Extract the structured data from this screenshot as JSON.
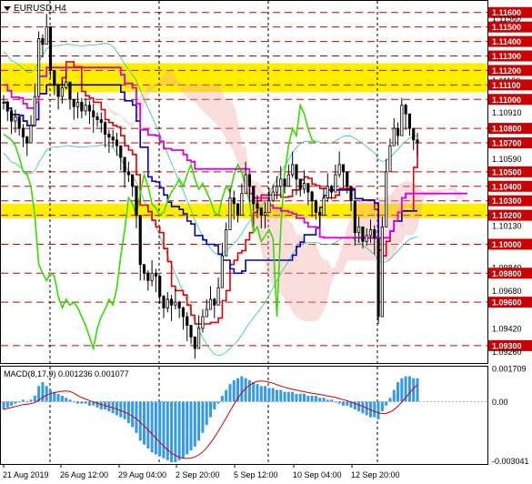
{
  "symbol": "EURUSD,H4",
  "macd_label": "MACD(8,17,9) 0.001236 0.001077",
  "colors": {
    "frame": "#000000",
    "level_line": "#cc0000",
    "level_box": "#cc0000",
    "zone": "#ffee00",
    "candle": "#000000",
    "red_line": "#dd0000",
    "blue_line": "#0000cc",
    "green_line": "#33dd00",
    "magenta_line": "#dd00dd",
    "cloud": "#f0a0a0",
    "macd_hist": "#3399ee",
    "macd_signal": "#cc0000",
    "band_line": "#22cc88"
  },
  "chart_data": {
    "type": "candlestick",
    "title": "EURUSD,H4",
    "ylim": [
      1.0918,
      1.1168
    ],
    "price_ticks": [
      "1.11600",
      "1.11560",
      "1.11500",
      "1.11400",
      "1.11300",
      "1.11200",
      "1.11130",
      "1.11100",
      "1.11000",
      "1.10910",
      "1.10800",
      "1.10700",
      "1.10590",
      "1.10500",
      "1.10400",
      "1.10300",
      "1.10200",
      "1.10130",
      "1.10000",
      "1.09840",
      "1.09800",
      "1.09680",
      "1.09600",
      "1.09420",
      "1.09300",
      "1.09260"
    ],
    "levels": [
      1.116,
      1.115,
      1.114,
      1.113,
      1.112,
      1.111,
      1.11,
      1.108,
      1.107,
      1.105,
      1.104,
      1.103,
      1.102,
      1.1,
      1.098,
      1.096,
      1.093
    ],
    "highlighted_levels": [
      "1.11600",
      "1.11500",
      "1.11400",
      "1.11300",
      "1.11200",
      "1.11100",
      "1.11000",
      "1.10800",
      "1.10700",
      "1.10500",
      "1.10400",
      "1.10300",
      "1.10200",
      "1.10000",
      "1.09800",
      "1.09600",
      "1.09300"
    ],
    "zones": [
      [
        1.1105,
        1.1125
      ],
      [
        1.1018,
        1.1028
      ]
    ],
    "x_labels": [
      "21 Aug 2019",
      "26 Aug 12:00",
      "29 Aug 04:00",
      "2 Sep 20:00",
      "5 Sep 12:00",
      "10 Sep 04:00",
      "12 Sep 20:00"
    ],
    "close": [
      1.1098,
      1.1092,
      1.1085,
      1.1088,
      1.108,
      1.1074,
      1.107,
      1.1082,
      1.1102,
      1.1142,
      1.1138,
      1.115,
      1.112,
      1.111,
      1.1102,
      1.1108,
      1.1112,
      1.11,
      1.1095,
      1.1098,
      1.1092,
      1.1096,
      1.1092,
      1.1088,
      1.1086,
      1.1084,
      1.1076,
      1.1074,
      1.1072,
      1.1068,
      1.106,
      1.105,
      1.1048,
      1.104,
      1.102,
      1.0986,
      1.098,
      1.0975,
      1.098,
      1.0978,
      1.0964,
      1.0956,
      1.0962,
      1.0958,
      1.096,
      1.0956,
      1.095,
      1.0944,
      1.0936,
      1.0928,
      1.0942,
      1.095,
      1.0955,
      1.0962,
      1.0958,
      1.097,
      1.0992,
      1.101,
      1.1032,
      1.1028,
      1.102,
      1.1035,
      1.1048,
      1.104,
      1.1028,
      1.1025,
      1.102,
      1.1022,
      1.103,
      1.1036,
      1.104,
      1.1045,
      1.104,
      1.1048,
      1.1055,
      1.1045,
      1.1038,
      1.1042,
      1.1036,
      1.103,
      1.1022,
      1.102,
      1.1032,
      1.104,
      1.1036,
      1.1048,
      1.1055,
      1.105,
      1.104,
      1.103,
      1.1008,
      1.1012,
      1.1002,
      1.1006,
      1.101,
      1.1004,
      1.095,
      1.1012,
      1.105,
      1.1068,
      1.108,
      1.1075,
      1.1096,
      1.109,
      1.108,
      1.1072,
      1.107
    ],
    "macd_values": [
      -0.0004,
      -0.0003,
      -0.0002,
      -0.0001,
      0.0,
      0.0001,
      0.0,
      0.0001,
      0.0003,
      0.0008,
      0.001,
      0.0008,
      0.0006,
      0.0005,
      0.0004,
      0.0003,
      0.0002,
      0.0001,
      0.0,
      -0.0001,
      -0.0001,
      -0.0001,
      -0.0002,
      -0.0002,
      -0.0003,
      -0.0004,
      -0.0004,
      -0.0005,
      -0.0006,
      -0.0007,
      -0.0008,
      -0.0009,
      -0.0011,
      -0.0013,
      -0.0016,
      -0.002,
      -0.0022,
      -0.0024,
      -0.0026,
      -0.0027,
      -0.0028,
      -0.0029,
      -0.003,
      -0.0031,
      -0.0031,
      -0.003,
      -0.0029,
      -0.0027,
      -0.0025,
      -0.0023,
      -0.002,
      -0.0016,
      -0.0012,
      -0.0008,
      -0.0004,
      -0.0001,
      0.0003,
      0.0006,
      0.0009,
      0.0011,
      0.0012,
      0.0013,
      0.0012,
      0.0011,
      0.001,
      0.0009,
      0.0008,
      0.0008,
      0.0007,
      0.0007,
      0.0006,
      0.0006,
      0.0005,
      0.0005,
      0.0005,
      0.0004,
      0.0004,
      0.0004,
      0.0003,
      0.0003,
      0.0003,
      0.0002,
      0.0002,
      0.0001,
      0.0001,
      0.0,
      -0.0001,
      -0.0002,
      -0.0002,
      -0.0003,
      -0.0004,
      -0.0005,
      -0.0006,
      -0.0007,
      -0.0008,
      -0.0008,
      -0.0009,
      -0.0005,
      -0.0002,
      0.0002,
      0.0006,
      0.001,
      0.0012,
      0.0013,
      0.0013,
      0.0012,
      0.0012
    ],
    "macd_ticks": [
      "0.001709",
      "0.00",
      "-0.003041"
    ],
    "macd_ylim": [
      -0.0031,
      0.0017
    ]
  }
}
